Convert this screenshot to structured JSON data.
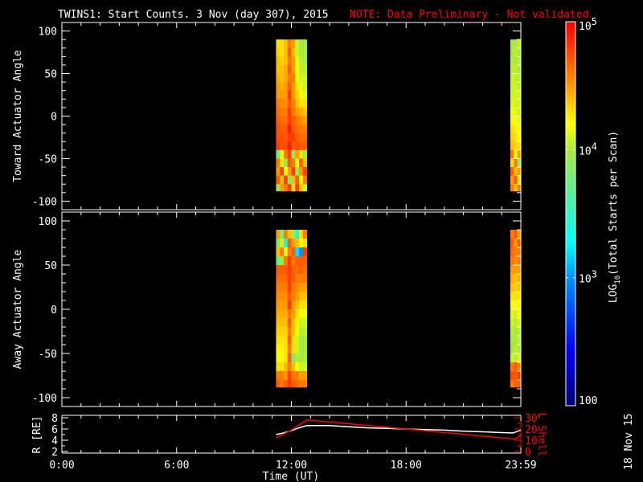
{
  "chart_data": {
    "type": "heatmap",
    "title": "TWINS1: Start Counts.  3 Nov (day 307), 2015",
    "note": "NOTE: Data Preliminary - Not validated",
    "xlabel": "Time (UT)",
    "x_tick_labels": [
      "0:00",
      "6:00",
      "12:00",
      "18:00",
      "23:59"
    ],
    "x_tick_values": [
      0,
      6,
      12,
      18,
      24
    ],
    "xlim": [
      0,
      24
    ],
    "colorbar": {
      "label": "LOG10(Total Starts per Scan)",
      "label_main": "LOG",
      "label_sub": "10",
      "label_rest": "(Total Starts per Scan)",
      "range_log10": [
        2,
        5
      ],
      "ticks": [
        {
          "base": "10",
          "exp": "5",
          "value": 5
        },
        {
          "base": "10",
          "exp": "4",
          "value": 4
        },
        {
          "base": "10",
          "exp": "3",
          "value": 3
        },
        {
          "base": "100",
          "exp": "",
          "value": 2
        }
      ]
    },
    "panels": [
      {
        "name": "toward",
        "ylabel": "Toward Actuator Angle",
        "ylim": [
          -110,
          110
        ],
        "y_tick_labels": [
          "100",
          "50",
          "0",
          "-50",
          "-100"
        ],
        "y_tick_values": [
          100,
          50,
          0,
          -50,
          -100
        ],
        "angle_bins_top_to_bottom": [
          85,
          75,
          65,
          55,
          45,
          35,
          25,
          15,
          5,
          -5,
          -15,
          -25,
          -35,
          -45,
          -55,
          -65,
          -75,
          -85
        ],
        "blocks": [
          {
            "t_start": 11.2,
            "t_end": 12.8,
            "values_log10": [
              [
                4.3,
                4.3,
                4.4,
                4.6,
                4.5,
                4.1,
                4.0,
                4.0
              ],
              [
                4.35,
                4.3,
                4.4,
                4.7,
                4.4,
                4.1,
                4.0,
                4.0
              ],
              [
                4.4,
                4.35,
                4.4,
                4.6,
                4.5,
                4.15,
                4.05,
                4.0
              ],
              [
                4.4,
                4.4,
                4.45,
                4.7,
                4.5,
                4.2,
                4.05,
                4.05
              ],
              [
                4.45,
                4.4,
                4.45,
                4.6,
                4.6,
                4.2,
                4.1,
                4.1
              ],
              [
                4.5,
                4.45,
                4.5,
                4.7,
                4.5,
                4.3,
                4.15,
                4.1
              ],
              [
                4.5,
                4.5,
                4.5,
                4.8,
                4.5,
                4.35,
                4.2,
                4.15
              ],
              [
                4.6,
                4.55,
                4.55,
                4.7,
                4.6,
                4.4,
                4.3,
                4.3
              ],
              [
                4.65,
                4.6,
                4.6,
                4.8,
                4.6,
                4.5,
                4.45,
                4.4
              ],
              [
                4.7,
                4.65,
                4.65,
                4.8,
                4.7,
                4.6,
                4.55,
                4.5
              ],
              [
                4.75,
                4.7,
                4.7,
                4.9,
                4.7,
                4.65,
                4.6,
                4.6
              ],
              [
                4.75,
                4.75,
                4.7,
                4.8,
                4.8,
                4.7,
                4.65,
                4.65
              ],
              [
                4.8,
                4.75,
                4.75,
                4.9,
                4.7,
                4.75,
                4.7,
                4.7
              ],
              [
                3.8,
                4.2,
                4.6,
                4.8,
                3.9,
                4.5,
                4.3,
                4.0
              ],
              [
                4.6,
                4.3,
                3.9,
                4.7,
                4.6,
                4.2,
                4.7,
                4.4
              ],
              [
                4.5,
                4.8,
                4.2,
                4.5,
                4.8,
                3.9,
                4.5,
                4.8
              ],
              [
                4.7,
                4.4,
                4.8,
                3.8,
                4.4,
                4.7,
                4.2,
                4.6
              ],
              [
                3.9,
                4.5,
                4.6,
                4.8,
                4.3,
                4.8,
                4.4,
                4.1
              ]
            ]
          },
          {
            "t_start": 23.45,
            "t_end": 24.0,
            "values_log10": [
              [
                4.0,
                4.0,
                4.05
              ],
              [
                4.0,
                4.05,
                4.0
              ],
              [
                4.05,
                4.0,
                4.05
              ],
              [
                4.05,
                4.05,
                4.0
              ],
              [
                4.1,
                4.05,
                4.05
              ],
              [
                4.1,
                4.1,
                4.05
              ],
              [
                4.1,
                4.1,
                4.1
              ],
              [
                4.15,
                4.1,
                4.1
              ],
              [
                4.2,
                4.15,
                4.1
              ],
              [
                4.25,
                4.2,
                4.15
              ],
              [
                4.3,
                4.25,
                4.2
              ],
              [
                4.35,
                4.3,
                4.25
              ],
              [
                4.4,
                4.35,
                4.3
              ],
              [
                4.6,
                4.2,
                4.5
              ],
              [
                4.3,
                4.6,
                3.9
              ],
              [
                4.7,
                4.4,
                4.5
              ],
              [
                4.5,
                4.7,
                4.3
              ],
              [
                4.6,
                4.4,
                4.6
              ]
            ]
          }
        ]
      },
      {
        "name": "away",
        "ylabel": "Away Actuator Angle",
        "ylim": [
          -110,
          110
        ],
        "y_tick_labels": [
          "100",
          "50",
          "0",
          "-50",
          "-100"
        ],
        "y_tick_values": [
          100,
          50,
          0,
          -50,
          -100
        ],
        "angle_bins_top_to_bottom": [
          85,
          75,
          65,
          55,
          45,
          35,
          25,
          15,
          5,
          -5,
          -15,
          -25,
          -35,
          -45,
          -55,
          -65,
          -75,
          -85
        ],
        "blocks": [
          {
            "t_start": 11.2,
            "t_end": 12.8,
            "values_log10": [
              [
                4.5,
                3.8,
                4.6,
                4.4,
                4.0,
                3.5,
                4.3,
                4.6
              ],
              [
                3.8,
                4.3,
                3.3,
                4.7,
                4.5,
                4.4,
                4.2,
                4.3
              ],
              [
                4.4,
                4.6,
                4.2,
                4.6,
                4.7,
                3.2,
                3.0,
                4.8
              ],
              [
                3.8,
                3.9,
                4.6,
                4.8,
                4.6,
                4.7,
                4.7,
                4.7
              ],
              [
                4.7,
                4.7,
                4.7,
                4.8,
                4.7,
                4.65,
                4.7,
                4.65
              ],
              [
                4.65,
                4.65,
                4.65,
                4.8,
                4.7,
                4.6,
                4.6,
                4.6
              ],
              [
                4.6,
                4.6,
                4.6,
                4.8,
                4.6,
                4.55,
                4.5,
                4.5
              ],
              [
                4.55,
                4.55,
                4.55,
                4.7,
                4.6,
                4.5,
                4.4,
                4.4
              ],
              [
                4.5,
                4.5,
                4.5,
                4.8,
                4.5,
                4.4,
                4.3,
                4.3
              ],
              [
                4.45,
                4.45,
                4.45,
                4.6,
                4.5,
                4.3,
                4.2,
                4.2
              ],
              [
                4.4,
                4.4,
                4.4,
                4.7,
                4.4,
                4.25,
                4.1,
                4.1
              ],
              [
                4.35,
                4.35,
                4.35,
                4.6,
                4.4,
                4.2,
                4.05,
                4.05
              ],
              [
                4.3,
                4.3,
                4.3,
                4.7,
                4.3,
                4.1,
                4.0,
                4.0
              ],
              [
                4.25,
                4.25,
                4.3,
                4.6,
                4.3,
                4.1,
                4.0,
                4.0
              ],
              [
                4.2,
                4.2,
                4.3,
                4.7,
                3.8,
                4.05,
                4.0,
                4.0
              ],
              [
                4.3,
                4.3,
                4.4,
                4.6,
                4.4,
                4.2,
                4.1,
                4.1
              ],
              [
                4.6,
                4.6,
                4.5,
                4.8,
                4.6,
                4.6,
                4.5,
                4.5
              ],
              [
                4.7,
                4.6,
                4.7,
                4.8,
                4.7,
                4.65,
                4.6,
                4.6
              ]
            ]
          },
          {
            "t_start": 23.45,
            "t_end": 24.0,
            "values_log10": [
              [
                4.6,
                4.7,
                4.5
              ],
              [
                4.7,
                4.5,
                4.7
              ],
              [
                4.65,
                4.6,
                4.6
              ],
              [
                4.6,
                4.55,
                4.6
              ],
              [
                4.5,
                4.5,
                4.5
              ],
              [
                4.45,
                4.4,
                4.45
              ],
              [
                4.4,
                4.35,
                4.4
              ],
              [
                4.3,
                4.3,
                4.3
              ],
              [
                4.2,
                4.2,
                4.25
              ],
              [
                4.15,
                4.1,
                4.2
              ],
              [
                4.1,
                4.05,
                4.1
              ],
              [
                4.05,
                4.0,
                4.05
              ],
              [
                4.0,
                4.0,
                4.05
              ],
              [
                4.0,
                4.05,
                4.0
              ],
              [
                4.1,
                4.05,
                4.1
              ],
              [
                4.6,
                4.7,
                4.6
              ],
              [
                4.75,
                4.7,
                4.8
              ],
              [
                4.6,
                4.7,
                4.7
              ]
            ]
          }
        ]
      }
    ],
    "ephemeris": {
      "left_label": "R [RE]",
      "left_label_main": "R [R",
      "left_label_sub": "E",
      "left_label_end": "]",
      "left_ylim": [
        2,
        8
      ],
      "left_tick_labels": [
        "2",
        "4",
        "6",
        "8"
      ],
      "left_tick_values": [
        2,
        4,
        6,
        8
      ],
      "right_label": "L Shell",
      "right_ylim": [
        0,
        30
      ],
      "right_tick_labels": [
        "0",
        "10",
        "20",
        "30"
      ],
      "right_tick_values": [
        0,
        10,
        20,
        30
      ],
      "series": [
        {
          "name": "R",
          "axis": "left",
          "color": "#ffffff",
          "x": [
            11.2,
            11.6,
            12.0,
            12.4,
            12.8,
            14.0,
            15.0,
            16.0,
            17.0,
            18.0,
            19.0,
            20.0,
            21.0,
            22.0,
            23.0,
            23.6,
            24.0
          ],
          "y": [
            5.0,
            5.3,
            5.7,
            6.2,
            6.6,
            6.6,
            6.4,
            6.2,
            6.1,
            6.0,
            5.9,
            5.8,
            5.6,
            5.5,
            5.35,
            5.3,
            5.8
          ]
        },
        {
          "name": "L Shell",
          "axis": "right",
          "color": "#ff0000",
          "x": [
            11.2,
            12.0,
            12.8,
            18.0,
            23.7,
            24.0
          ],
          "y": [
            12,
            19,
            28,
            20,
            11,
            14
          ]
        }
      ]
    },
    "date_stamp": "18 Nov 15"
  }
}
